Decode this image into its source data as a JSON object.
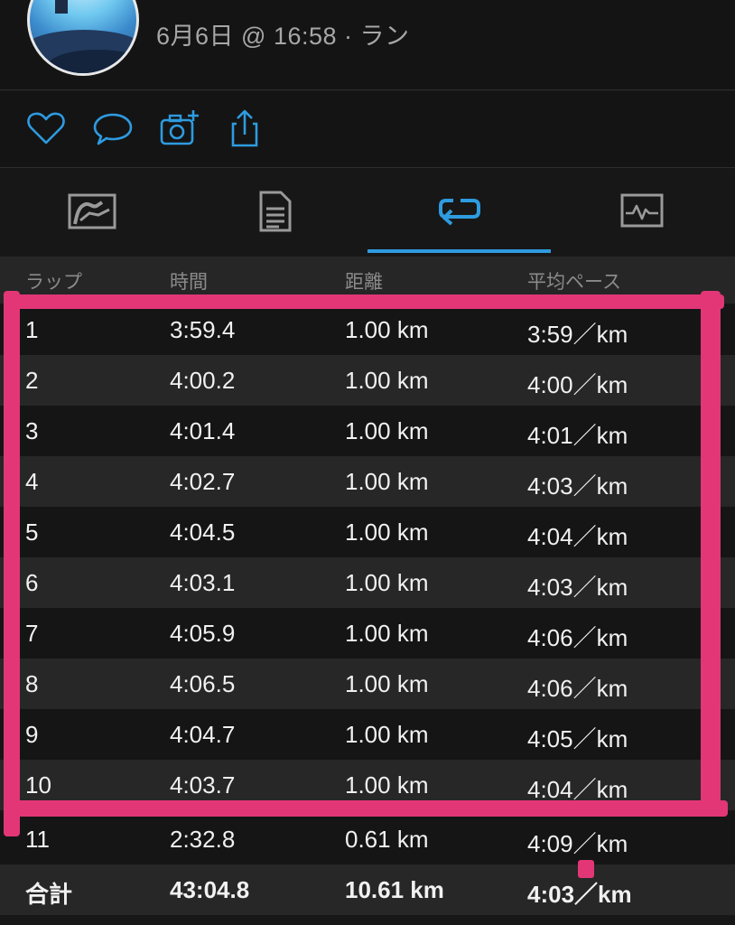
{
  "header": {
    "subtitle": "6月6日 @ 16:58 · ラン"
  },
  "actions": [
    {
      "name": "like",
      "icon": "heart-icon"
    },
    {
      "name": "comment",
      "icon": "comment-icon"
    },
    {
      "name": "add-photo",
      "icon": "camera-plus-icon"
    },
    {
      "name": "share",
      "icon": "share-icon"
    }
  ],
  "tabs": [
    {
      "name": "map",
      "icon": "map-icon"
    },
    {
      "name": "details",
      "icon": "document-icon"
    },
    {
      "name": "laps",
      "icon": "laps-icon",
      "active": true
    },
    {
      "name": "charts",
      "icon": "chart-icon"
    }
  ],
  "laps_table": {
    "headers": [
      "ラップ",
      "時間",
      "距離",
      "平均ペース"
    ],
    "rows": [
      {
        "lap": "1",
        "time": "3:59.4",
        "distance": "1.00 km",
        "pace": "3:59／km"
      },
      {
        "lap": "2",
        "time": "4:00.2",
        "distance": "1.00 km",
        "pace": "4:00／km"
      },
      {
        "lap": "3",
        "time": "4:01.4",
        "distance": "1.00 km",
        "pace": "4:01／km"
      },
      {
        "lap": "4",
        "time": "4:02.7",
        "distance": "1.00 km",
        "pace": "4:03／km"
      },
      {
        "lap": "5",
        "time": "4:04.5",
        "distance": "1.00 km",
        "pace": "4:04／km"
      },
      {
        "lap": "6",
        "time": "4:03.1",
        "distance": "1.00 km",
        "pace": "4:03／km"
      },
      {
        "lap": "7",
        "time": "4:05.9",
        "distance": "1.00 km",
        "pace": "4:06／km"
      },
      {
        "lap": "8",
        "time": "4:06.5",
        "distance": "1.00 km",
        "pace": "4:06／km"
      },
      {
        "lap": "9",
        "time": "4:04.7",
        "distance": "1.00 km",
        "pace": "4:05／km"
      },
      {
        "lap": "10",
        "time": "4:03.7",
        "distance": "1.00 km",
        "pace": "4:04／km"
      },
      {
        "lap": "11",
        "time": "2:32.8",
        "distance": "0.61 km",
        "pace": "4:09／km"
      }
    ],
    "total": {
      "lap": "合計",
      "time": "43:04.8",
      "distance": "10.61 km",
      "pace": "4:03／km"
    }
  },
  "colors": {
    "accent": "#2e9be0",
    "highlight": "#e23677",
    "background": "#171717"
  }
}
